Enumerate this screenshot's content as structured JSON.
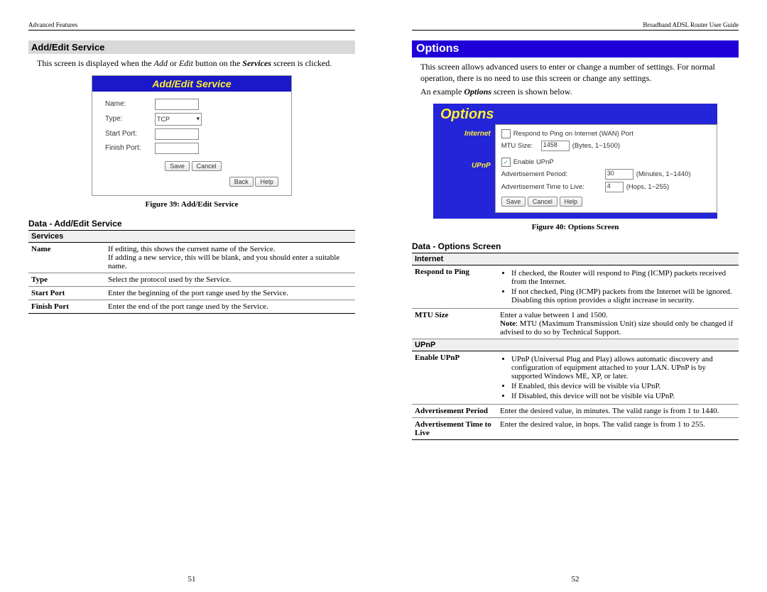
{
  "left": {
    "header": "Advanced Features",
    "section": "Add/Edit Service",
    "intro_pre": "This screen is displayed when the ",
    "intro_add": "Add",
    "intro_or": " or ",
    "intro_edit": "Edit",
    "intro_mid": " button on the ",
    "intro_services": "Services",
    "intro_post": " screen is clicked.",
    "fig39": {
      "title": "Add/Edit Service",
      "labels": {
        "name": "Name:",
        "type": "Type:",
        "start": "Start Port:",
        "finish": "Finish Port:"
      },
      "type_value": "TCP",
      "buttons": {
        "save": "Save",
        "cancel": "Cancel",
        "back": "Back",
        "help": "Help"
      }
    },
    "fig39_caption": "Figure 39: Add/Edit Service",
    "data_heading": "Data - Add/Edit Service",
    "table": {
      "group": "Services",
      "rows": [
        {
          "k": "Name",
          "v": "If editing, this shows the current name of the Service.\nIf adding a new service, this will be blank, and you should enter a suitable name."
        },
        {
          "k": "Type",
          "v": "Select the protocol used by the Service."
        },
        {
          "k": "Start Port",
          "v": "Enter the beginning of the port range used by the Service."
        },
        {
          "k": "Finish Port",
          "v": "Enter the end of the port range used by the Service."
        }
      ]
    },
    "pagenum": "51"
  },
  "right": {
    "header": "Broadband ADSL Router User Guide",
    "section": "Options",
    "intro": "This screen allows advanced users to enter or change a number of settings. For normal operation, there is no need to use this screen or change any settings.",
    "intro2_pre": "An example ",
    "intro2_bi": "Options",
    "intro2_post": " screen is shown below.",
    "fig40": {
      "title": "Options",
      "side": {
        "internet": "Internet",
        "upnp": "UPnP"
      },
      "rows": {
        "ping": "Respond to Ping on Internet (WAN) Port",
        "mtu_label": "MTU Size:",
        "mtu_value": "1458",
        "mtu_hint": "(Bytes, 1~1500)",
        "enable_upnp": "Enable UPnP",
        "adv_period": "Advertisement Period:",
        "adv_period_value": "30",
        "adv_period_hint": "(Minutes, 1~1440)",
        "adv_ttl": "Advertisement Time to Live:",
        "adv_ttl_value": "4",
        "adv_ttl_hint": "(Hops, 1~255)"
      },
      "buttons": {
        "save": "Save",
        "cancel": "Cancel",
        "help": "Help"
      }
    },
    "fig40_caption": "Figure 40: Options Screen",
    "data_heading": "Data - Options Screen",
    "table": {
      "group1": "Internet",
      "ping_k": "Respond to Ping",
      "ping_b1": "If checked, the Router will respond to Ping (ICMP) packets received from the Internet.",
      "ping_b2": "If not checked, Ping (ICMP) packets from the Internet will be ignored. Disabling this option provides a slight increase in security.",
      "mtu_k": "MTU Size",
      "mtu_v1": "Enter a value between 1 and 1500.",
      "mtu_note_b": "Note",
      "mtu_note_rest": ": MTU (Maximum Transmission Unit) size should only be changed if advised to do so by Technical Support.",
      "group2": "UPnP",
      "upnp_k": "Enable UPnP",
      "upnp_b1": "UPnP (Universal Plug and Play) allows automatic discovery and configuration of equipment attached to your LAN. UPnP is by supported Windows ME, XP, or later.",
      "upnp_b2": "If Enabled, this device will be visible via UPnP.",
      "upnp_b3": "If Disabled, this device will not be visible via UPnP.",
      "advp_k": "Advertisement Period",
      "advp_v": "Enter the desired value, in minutes. The valid range is from 1 to 1440.",
      "advt_k": "Advertisement Time to Live",
      "advt_v": "Enter the desired value, in hops. The valid range is from 1 to 255."
    },
    "pagenum": "52"
  }
}
